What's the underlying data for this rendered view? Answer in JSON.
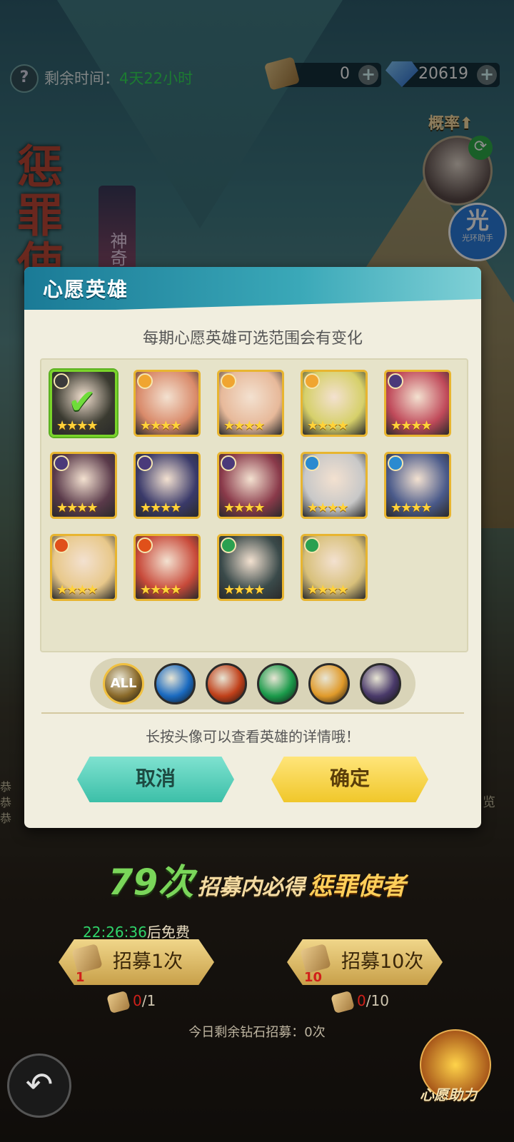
{
  "topbar": {
    "time_label": "剩余时间：",
    "time_value": "4天22小时",
    "scroll_count": "0",
    "diamond_count": "20619"
  },
  "side": {
    "prob_label": "概率",
    "banner_text": "神奇",
    "title_art": "惩罪使",
    "assist_big": "光",
    "assist_small": "光环助手"
  },
  "modal": {
    "title": "心愿英雄",
    "subtitle": "每期心愿英雄可选范围会有变化",
    "hint": "长按头像可以查看英雄的详情哦！",
    "cancel_label": "取消",
    "confirm_label": "确定",
    "heroes": [
      {
        "stars": "★★★★",
        "faction": "dark",
        "selected": true,
        "color": "#3a3a30"
      },
      {
        "stars": "★★★★",
        "faction": "light",
        "selected": false,
        "color": "#d98a6a"
      },
      {
        "stars": "★★★★",
        "faction": "light",
        "selected": false,
        "color": "#e7b99a"
      },
      {
        "stars": "★★★★",
        "faction": "light",
        "selected": false,
        "color": "#d6d06a"
      },
      {
        "stars": "★★★★",
        "faction": "void",
        "selected": false,
        "color": "#c04a5a"
      },
      {
        "stars": "★★★★",
        "faction": "void",
        "selected": false,
        "color": "#5a3a4a"
      },
      {
        "stars": "★★★★",
        "faction": "void",
        "selected": false,
        "color": "#3a3a6a"
      },
      {
        "stars": "★★★★",
        "faction": "void",
        "selected": false,
        "color": "#8a3a4a"
      },
      {
        "stars": "★★★★",
        "faction": "water",
        "selected": false,
        "color": "#c8c8c8"
      },
      {
        "stars": "★★★★",
        "faction": "water",
        "selected": false,
        "color": "#4a5a8a"
      },
      {
        "stars": "★★★★",
        "faction": "fire",
        "selected": false,
        "color": "#e8c88a"
      },
      {
        "stars": "★★★★",
        "faction": "fire",
        "selected": false,
        "color": "#c84a3a"
      },
      {
        "stars": "★★★★",
        "faction": "wind",
        "selected": false,
        "color": "#3a4a4a"
      },
      {
        "stars": "★★★★",
        "faction": "wind",
        "selected": false,
        "color": "#d8c07a"
      }
    ],
    "filters": [
      {
        "name": "all",
        "label": "ALL",
        "color": "#8a6a2a"
      },
      {
        "name": "water",
        "label": "",
        "color": "#1a6ac0"
      },
      {
        "name": "fire",
        "label": "",
        "color": "#c0401a"
      },
      {
        "name": "wind",
        "label": "",
        "color": "#1a9a4a"
      },
      {
        "name": "light",
        "label": "",
        "color": "#e09a2a"
      },
      {
        "name": "void",
        "label": "",
        "color": "#4a3a6a"
      }
    ]
  },
  "faction_colors": {
    "light": "#f0a530",
    "void": "#4a3a7a",
    "water": "#2a8ad0",
    "fire": "#e0501a",
    "wind": "#2aa050",
    "dark": "#3a3a3a"
  },
  "bottom": {
    "guarantee_num": "79次",
    "guarantee_mid": "招募内必得",
    "guarantee_hero": "惩罪使者",
    "free_time": "22:26:36",
    "free_suffix": "后免费",
    "recruit1_label": "招募1次",
    "recruit1_num": "1",
    "recruit10_label": "招募10次",
    "recruit10_num": "10",
    "cost1_zero": "0",
    "cost1_total": "/1",
    "cost10_zero": "0",
    "cost10_total": "/10",
    "today_remaining": "今日剩余钻石招募：0次",
    "wish_help_label": "心愿助力",
    "left_strip": [
      "恭",
      "恭",
      "恭"
    ],
    "right_strip": "览"
  }
}
